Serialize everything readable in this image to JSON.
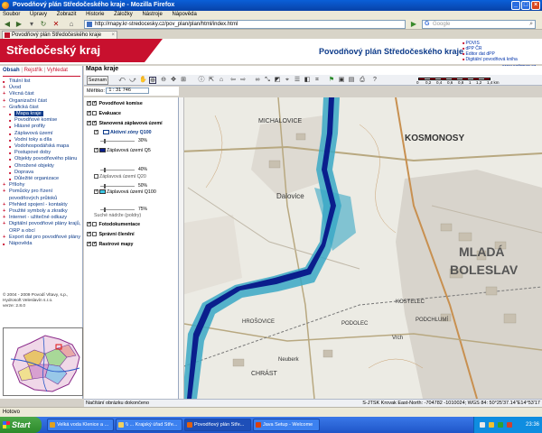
{
  "browser": {
    "title": "Povodňový plán Středočeského kraje - Mozilla Firefox",
    "menu": [
      "Soubor",
      "Úpravy",
      "Zobrazit",
      "Historie",
      "Záložky",
      "Nástroje",
      "Nápověda"
    ],
    "url": "http://mapy.kr-stredocesky.cz/pov_plan/plan/html/index.html",
    "search_placeholder": "Google",
    "tab_label": "Povodňový plán Středočeského kraje",
    "status": "Hotovo"
  },
  "header": {
    "logo": "Středočeský kraj",
    "title": "Povodňový plán Středočeského kraje",
    "links": [
      "POVIS",
      "dPP ČR",
      "Editor dat dPP",
      "Digitální povodňová kniha"
    ],
    "url": "www.webmap.cz"
  },
  "left": {
    "tab_contents": "Obsah",
    "tab_search": "Rejstřík",
    "tab_find": "Vyhledat",
    "nav": [
      {
        "label": "Titulní list",
        "kind": "top"
      },
      {
        "label": "Úvod",
        "kind": "plus"
      },
      {
        "label": "Věcná část",
        "kind": "plus"
      },
      {
        "label": "Organizační část",
        "kind": "plus"
      },
      {
        "label": "Grafická část",
        "kind": "open"
      },
      {
        "label": "Mapa kraje",
        "kind": "sub-active"
      },
      {
        "label": "Povodňové komise",
        "kind": "sub"
      },
      {
        "label": "Hlásné profily",
        "kind": "sub"
      },
      {
        "label": "Záplavová území",
        "kind": "sub"
      },
      {
        "label": "Vodní toky a díla",
        "kind": "sub"
      },
      {
        "label": "Vodohospodářská mapa",
        "kind": "sub"
      },
      {
        "label": "Postupové doby",
        "kind": "sub"
      },
      {
        "label": "Objekty povodňového plánu",
        "kind": "sub"
      },
      {
        "label": "Ohrožené objekty",
        "kind": "sub"
      },
      {
        "label": "Doprava",
        "kind": "sub"
      },
      {
        "label": "Důležité organizace",
        "kind": "sub"
      },
      {
        "label": "Přílohy",
        "kind": "plus"
      },
      {
        "label": "Pomůcky pro řízení povodňových průtoků",
        "kind": "plus"
      },
      {
        "label": "Přehled spojení - kontakty",
        "kind": "plus"
      },
      {
        "label": "Použité symboly a zkratky",
        "kind": "plus"
      },
      {
        "label": "Internet - užitečné odkazy",
        "kind": "plus"
      },
      {
        "label": "Digitální povodňové plány krajů, ORP a obcí",
        "kind": "plus"
      },
      {
        "label": "Export dat pro povodňové plány",
        "kind": "plus"
      },
      {
        "label": "Nápověda",
        "kind": "top"
      }
    ],
    "copyright": [
      "© 2004 - 2009 Povodí Vltavy, s.p.,",
      "Hydrosoft Veleslavín s.r.o.",
      "verze: 2.8.0"
    ]
  },
  "main": {
    "title": "Mapa kraje",
    "zoom_button": "Seznam",
    "scale_label": "Měřítko:",
    "scale_value": "1 : 31 746",
    "scale_ticks": [
      "0",
      "0,2",
      "0,4",
      "0,6",
      "0,8",
      "1",
      "1,2",
      "1,4 km"
    ],
    "layers": {
      "povodnove_komise": "Povodňové komise",
      "evakuace": "Evakuace",
      "stanovena": "Stanovená záplavová území",
      "aktivni_zony": "Aktivní zóny Q100",
      "q5": "Záplavová území Q5",
      "q20": "Záplavová území Q20",
      "q100": "Záplavová území Q100",
      "suche": "Suché nádrže (poldry)",
      "fotodokumentace": "Fotodokumentace",
      "spravni_cleneni": "Správní členění",
      "rastrove": "Rastrové mapy"
    },
    "opacities": [
      "30%",
      "40%",
      "50%",
      "75%"
    ],
    "status": "Načítání obrázku dokončeno",
    "coords": "S-JTSK Krovak East-North: -704782 -1010024; WGS 84: 50°25'37.14\"E14°53'17"
  },
  "map_labels": [
    "MICHALOVICE",
    "KOSMONOSY",
    "Dalovice",
    "MLADÁ",
    "BOLESLAV",
    "PODCHLUMÍ",
    "KOSTELEC",
    "Neuberk",
    "CHRÁST",
    "PODOLEC",
    "HROŠOVICE",
    "Vrch"
  ],
  "taskbar": {
    "start": "Start",
    "tasks": [
      "Velká voda Klenice a ...",
      "\\\\ ... Krajský úřad Stře...",
      "Povodňový plán Stře...",
      "Java Setup - Welcome"
    ],
    "clock": "23:36"
  },
  "colors": {
    "brand": "#c8102e",
    "navy": "#0d3b8a",
    "q5": "#0a1e8c",
    "q100": "#3ec8e6",
    "flood": "#3aa8c6"
  }
}
